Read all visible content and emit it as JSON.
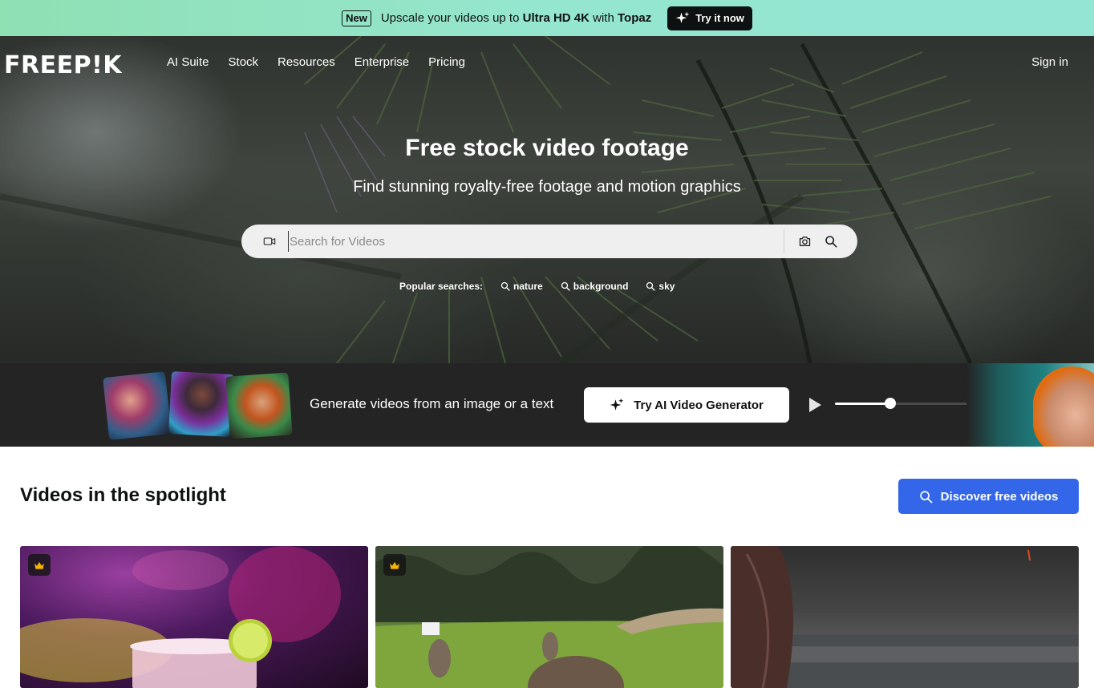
{
  "promo": {
    "badge": "New",
    "text_prefix": "Upscale your videos up to ",
    "text_bold1": "Ultra HD 4K",
    "text_mid": " with ",
    "text_bold2": "Topaz",
    "button": "Try it now"
  },
  "nav": {
    "logo": "FREEP!K",
    "links": [
      "AI Suite",
      "Stock",
      "Resources",
      "Enterprise",
      "Pricing"
    ],
    "sign_in": "Sign in"
  },
  "hero": {
    "title": "Free stock video footage",
    "subtitle": "Find stunning royalty-free footage and motion graphics",
    "search_placeholder": "Search for Videos",
    "popular_label": "Popular searches:",
    "popular_tags": [
      "nature",
      "background",
      "sky"
    ]
  },
  "ai_banner": {
    "text": "Generate videos from an image or a text",
    "button": "Try AI Video Generator",
    "progress": 0.36
  },
  "spotlight": {
    "title": "Videos in the spotlight",
    "discover_button": "Discover free videos"
  },
  "colors": {
    "promo_bg": "#94e5d4",
    "accent_blue": "#3366e8",
    "banner_bg": "#242424",
    "crown": "#f5b400"
  },
  "icons": [
    "sparkle-icon",
    "video-camera-icon",
    "camera-icon",
    "search-icon",
    "play-icon",
    "crown-icon"
  ]
}
